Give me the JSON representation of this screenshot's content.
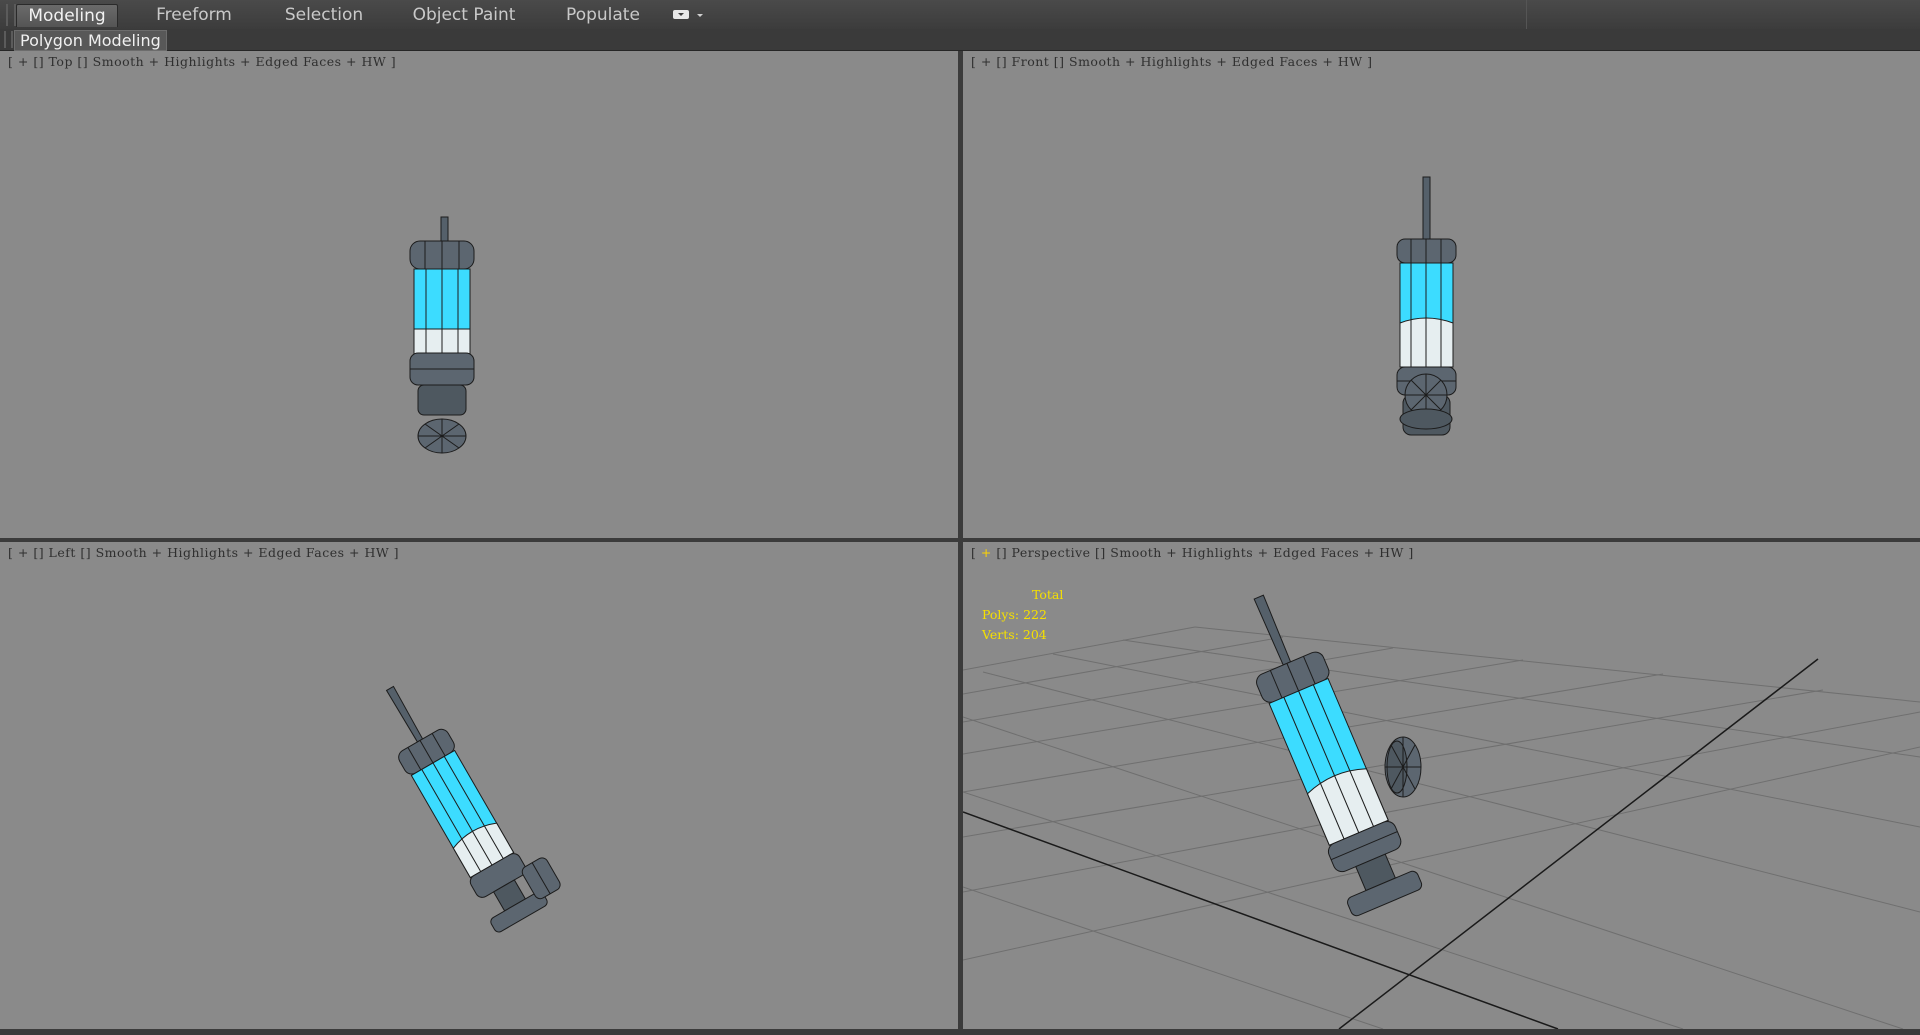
{
  "ribbon": {
    "tabs": [
      {
        "label": "Modeling",
        "active": true
      },
      {
        "label": "Freeform",
        "active": false
      },
      {
        "label": "Selection",
        "active": false
      },
      {
        "label": "Object Paint",
        "active": false
      },
      {
        "label": "Populate",
        "active": false
      }
    ],
    "dropdown_icon": "panel-toggle-icon"
  },
  "panel": {
    "label": "Polygon Modeling"
  },
  "viewports": [
    {
      "id": "top",
      "name": "Top",
      "mode": "Smooth + Highlights + Edged Faces + HW",
      "active": false
    },
    {
      "id": "front",
      "name": "Front",
      "mode": "Smooth + Highlights + Edged Faces + HW",
      "active": false
    },
    {
      "id": "left",
      "name": "Left",
      "mode": "Smooth + Highlights + Edged Faces + HW",
      "active": false
    },
    {
      "id": "persp",
      "name": "Perspective",
      "mode": "Smooth + Highlights + Edged Faces + HW",
      "active": true
    }
  ],
  "stats": {
    "header": "Total",
    "polys": "Polys: 222",
    "verts": "Verts: 204"
  },
  "colors": {
    "viewport_bg": "#8a8a8a",
    "liquid": "#3cdcff",
    "steel": "#5c6670",
    "stats": "#f5e000",
    "active_plus": "#ffd400"
  }
}
